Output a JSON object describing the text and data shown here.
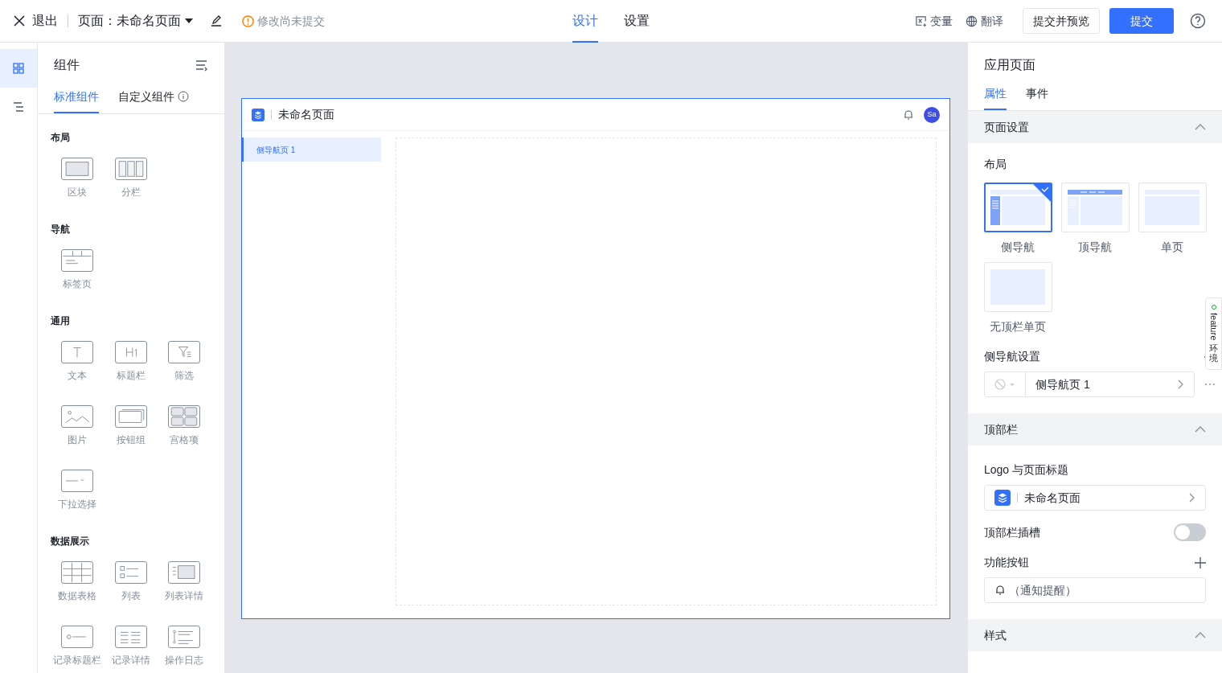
{
  "topbar": {
    "exit": "退出",
    "page_title": "页面：未命名页面",
    "status": "修改尚未提交",
    "tabs": [
      {
        "label": "设计",
        "selected": true
      },
      {
        "label": "设置",
        "selected": false
      }
    ],
    "actions": [
      {
        "label": "变量",
        "kind": "variable"
      },
      {
        "label": "翻译",
        "kind": "translate"
      }
    ],
    "preview_button": "提交并预览",
    "submit_button": "提交"
  },
  "rail": [
    {
      "kind": "components",
      "selected": true
    },
    {
      "kind": "outline",
      "selected": false
    }
  ],
  "components_panel": {
    "title": "组件",
    "tabs": [
      {
        "label": "标准组件",
        "selected": true
      },
      {
        "label": "自定义组件",
        "selected": false
      }
    ],
    "groups": [
      {
        "title": "布局",
        "items": [
          {
            "label": "区块",
            "kind": "block"
          },
          {
            "label": "分栏",
            "kind": "columns"
          }
        ]
      },
      {
        "title": "导航",
        "items": [
          {
            "label": "标签页",
            "kind": "tabs"
          }
        ]
      },
      {
        "title": "通用",
        "items": [
          {
            "label": "文本",
            "kind": "text"
          },
          {
            "label": "标题栏",
            "kind": "heading"
          },
          {
            "label": "筛选",
            "kind": "filter"
          },
          {
            "label": "图片",
            "kind": "image"
          },
          {
            "label": "按钮组",
            "kind": "buttons"
          },
          {
            "label": "宫格项",
            "kind": "grid"
          },
          {
            "label": "下拉选择",
            "kind": "select"
          }
        ]
      },
      {
        "title": "数据展示",
        "items": [
          {
            "label": "数据表格",
            "kind": "table"
          },
          {
            "label": "列表",
            "kind": "list"
          },
          {
            "label": "列表详情",
            "kind": "listdetail"
          },
          {
            "label": "记录标题栏",
            "kind": "recordtitle"
          },
          {
            "label": "记录详情",
            "kind": "recorddetail"
          },
          {
            "label": "操作日志",
            "kind": "log"
          }
        ]
      }
    ]
  },
  "canvas": {
    "page_title": "未命名页面",
    "avatar": "Sa",
    "nav_items": [
      {
        "label": "侧导航页 1",
        "selected": true
      }
    ]
  },
  "properties": {
    "title": "应用页面",
    "tabs": [
      {
        "label": "属性",
        "selected": true
      },
      {
        "label": "事件",
        "selected": false
      }
    ],
    "page_settings": {
      "title": "页面设置",
      "expanded": true,
      "layout_label": "布局",
      "layouts": [
        {
          "label": "侧导航",
          "kind": "side",
          "selected": true
        },
        {
          "label": "顶导航",
          "kind": "top",
          "selected": false
        },
        {
          "label": "单页",
          "kind": "single",
          "selected": false
        },
        {
          "label": "无顶栏单页",
          "kind": "notop",
          "selected": false
        }
      ],
      "side_nav_label": "侧导航设置",
      "side_nav_items": [
        {
          "label": "侧导航页 1"
        }
      ]
    },
    "topbar_section": {
      "title": "顶部栏",
      "expanded": true,
      "logo_label": "Logo 与页面标题",
      "logo_value": "未命名页面",
      "slot_label": "顶部栏插槽",
      "slot_on": false,
      "buttons_label": "功能按钮",
      "buttons": [
        {
          "label": "（通知提醒）"
        }
      ]
    },
    "style_section": {
      "title": "样式",
      "expanded": true
    }
  },
  "feature_tab": {
    "label": "feature",
    "env": "环境"
  }
}
